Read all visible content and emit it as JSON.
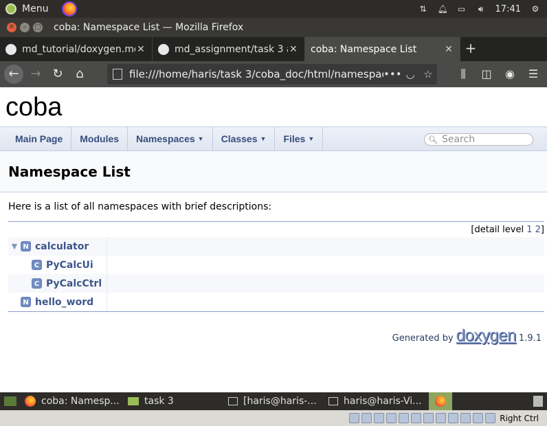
{
  "system": {
    "menu_label": "Menu",
    "clock": "17:41"
  },
  "window": {
    "title": "coba: Namespace List — Mozilla Firefox"
  },
  "tabs": [
    {
      "label": "md_tutorial/doxygen.md",
      "close": "✕"
    },
    {
      "label": "md_assignment/task 3 at",
      "close": "✕"
    },
    {
      "label": "coba: Namespace List",
      "close": "✕"
    }
  ],
  "new_tab": "+",
  "url": "file:///home/haris/task 3/coba_doc/html/namespaces.html",
  "url_more": "•••",
  "doxygen": {
    "project_name": "coba",
    "nav": [
      {
        "label": "Main Page",
        "dropdown": false
      },
      {
        "label": "Modules",
        "dropdown": false
      },
      {
        "label": "Namespaces",
        "dropdown": true
      },
      {
        "label": "Classes",
        "dropdown": true
      },
      {
        "label": "Files",
        "dropdown": true
      }
    ],
    "search_placeholder": "Search",
    "page_title": "Namespace List",
    "intro": "Here is a list of all namespaces with brief descriptions:",
    "detail_level_label": "[detail level",
    "detail_levels": [
      "1",
      "2"
    ],
    "detail_close": "]",
    "namespaces": [
      {
        "badge": "N",
        "name": "calculator",
        "expanded": true,
        "children": [
          {
            "badge": "C",
            "name": "PyCalcUi"
          },
          {
            "badge": "C",
            "name": "PyCalcCtrl"
          }
        ]
      },
      {
        "badge": "N",
        "name": "hello_word",
        "expanded": false,
        "children": []
      }
    ],
    "footer_text": "Generated by",
    "footer_logo": "doxygen",
    "footer_version": "1.9.1"
  },
  "taskbar": {
    "items": [
      {
        "label": "coba: Namesp..."
      },
      {
        "label": "task 3"
      },
      {
        "label": "[haris@haris-..."
      },
      {
        "label": "haris@haris-Vi..."
      }
    ]
  },
  "vm_status": {
    "host_key": "Right Ctrl"
  }
}
